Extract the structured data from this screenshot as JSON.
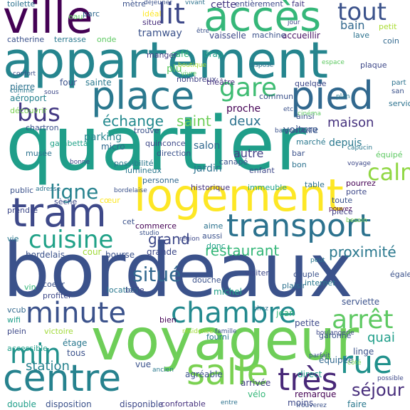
{
  "words": [
    {
      "text": "quartier",
      "color": "#1f9e89"
    },
    {
      "text": "bordeaux",
      "color": "#3b528b"
    },
    {
      "text": "appartement",
      "color": "#25858e"
    },
    {
      "text": "voyageur",
      "color": "#6ece58"
    },
    {
      "text": "logement",
      "color": "#fde725"
    },
    {
      "text": "ville",
      "color": "#440154"
    },
    {
      "text": "accès",
      "color": "#35b779"
    },
    {
      "text": "place",
      "color": "#2a788e"
    },
    {
      "text": "pied",
      "color": "#31688e"
    },
    {
      "text": "tram",
      "color": "#3e4989"
    },
    {
      "text": "transport",
      "color": "#2c728e"
    },
    {
      "text": "centre",
      "color": "#26828e"
    },
    {
      "text": "chambre",
      "color": "#23898e"
    },
    {
      "text": "minute",
      "color": "#3b528b"
    },
    {
      "text": "salle",
      "color": "#7ad151"
    },
    {
      "text": "très",
      "color": "#482878"
    },
    {
      "text": "rue",
      "color": "#21918c"
    },
    {
      "text": "arrêt",
      "color": "#5ec962"
    },
    {
      "text": "cuisine",
      "color": "#1fa187"
    },
    {
      "text": "min",
      "color": "#21918c"
    },
    {
      "text": "gare",
      "color": "#3fbc73"
    },
    {
      "text": "lit",
      "color": "#3e4989"
    },
    {
      "text": "tout",
      "color": "#3b528b"
    },
    {
      "text": "bus",
      "color": "#443983"
    },
    {
      "text": "calme",
      "color": "#90d743"
    },
    {
      "text": "ligne",
      "color": "#26828e"
    },
    {
      "text": "situé",
      "color": "#31688e"
    },
    {
      "text": "restaurant",
      "color": "#35b779"
    },
    {
      "text": "proximité",
      "color": "#2a788e"
    },
    {
      "text": "séjour",
      "color": "#472d7b"
    },
    {
      "text": "station",
      "color": "#26828e"
    },
    {
      "text": "grand",
      "color": "#3e4989"
    },
    {
      "text": "maison",
      "color": "#46327e"
    },
    {
      "text": "saint",
      "color": "#6ece58"
    },
    {
      "text": "deux",
      "color": "#2c728e"
    },
    {
      "text": "échange",
      "color": "#23898e"
    },
    {
      "text": "proche",
      "color": "#440154"
    },
    {
      "text": "quai",
      "color": "#1f9e89"
    },
    {
      "text": "bain",
      "color": "#31688e"
    },
    {
      "text": "tramway",
      "color": "#3b528b"
    },
    {
      "text": "cette",
      "color": "#453781"
    },
    {
      "text": "jardin",
      "color": "#2c728e"
    },
    {
      "text": "autre",
      "color": "#424086"
    },
    {
      "text": "parking",
      "color": "#25858e"
    },
    {
      "text": "salon",
      "color": "#31688e"
    },
    {
      "text": "depuis",
      "color": "#2a788e"
    },
    {
      "text": "voiture",
      "color": "#38588c"
    },
    {
      "text": "plu",
      "color": "#5ec962"
    },
    {
      "text": "vaisselle",
      "color": "#3e4989"
    },
    {
      "text": "accueillir",
      "color": "#471164"
    },
    {
      "text": "terrasse",
      "color": "#2a788e"
    },
    {
      "text": "catherine",
      "color": "#3b528b"
    },
    {
      "text": "pierre",
      "color": "#2c728e"
    },
    {
      "text": "aéroport",
      "color": "#26828e"
    },
    {
      "text": "chartron",
      "color": "#3b528b"
    },
    {
      "text": "quelque",
      "color": "#3e4989"
    },
    {
      "text": "commerce",
      "color": "#440154"
    },
    {
      "text": "historique",
      "color": "#46327e"
    },
    {
      "text": "immeuble",
      "color": "#1fa187"
    },
    {
      "text": "personne",
      "color": "#31688e"
    },
    {
      "text": "toute",
      "color": "#3b528b"
    },
    {
      "text": "pièce",
      "color": "#423f85"
    },
    {
      "text": "vcub",
      "color": "#31688e"
    },
    {
      "text": "wifi",
      "color": "#1f9e89"
    },
    {
      "text": "plein",
      "color": "#3e4989"
    },
    {
      "text": "victoire",
      "color": "#a0da39"
    },
    {
      "text": "tous",
      "color": "#3b528b"
    },
    {
      "text": "étage",
      "color": "#2a788e"
    },
    {
      "text": "disposition",
      "color": "#3b528b"
    },
    {
      "text": "disponible",
      "color": "#3e4989"
    },
    {
      "text": "arrivée",
      "color": "#433e85"
    },
    {
      "text": "vélo",
      "color": "#35b779"
    },
    {
      "text": "moins",
      "color": "#3e4989"
    },
    {
      "text": "remarque",
      "color": "#440154"
    },
    {
      "text": "faire",
      "color": "#2a788e"
    },
    {
      "text": "équipée",
      "color": "#31688e"
    },
    {
      "text": "linge",
      "color": "#3b528b"
    },
    {
      "text": "direct",
      "color": "#1f9e89"
    },
    {
      "text": "agréable",
      "color": "#3b528b"
    },
    {
      "text": "confortable",
      "color": "#46327e"
    },
    {
      "text": "double",
      "color": "#1f9e89"
    },
    {
      "text": "toilette",
      "color": "#2c728e"
    },
    {
      "text": "eau",
      "color": "#5ec962"
    },
    {
      "text": "parc",
      "color": "#31688e"
    },
    {
      "text": "mètre",
      "color": "#3b528b"
    },
    {
      "text": "idéal",
      "color": "#fde725"
    },
    {
      "text": "situe",
      "color": "#472d7b"
    },
    {
      "text": "fait",
      "color": "#443983"
    },
    {
      "text": "entièrement",
      "color": "#3e4989"
    },
    {
      "text": "onde",
      "color": "#5ec962"
    },
    {
      "text": "machine",
      "color": "#3b528b"
    },
    {
      "text": "lave",
      "color": "#2c728e"
    },
    {
      "text": "coin",
      "color": "#31688e"
    },
    {
      "text": "petit",
      "color": "#aadc32"
    },
    {
      "text": "café",
      "color": "#35b779"
    },
    {
      "text": "drap",
      "color": "#1f9e89"
    },
    {
      "text": "manger",
      "color": "#433e85"
    },
    {
      "text": "sainte",
      "color": "#2a788e"
    },
    {
      "text": "four",
      "color": "#3b528b"
    },
    {
      "text": "nombreux",
      "color": "#414487"
    },
    {
      "text": "théâtre",
      "color": "#46327e"
    },
    {
      "text": "commun",
      "color": "#3b528b"
    },
    {
      "text": "plaque",
      "color": "#3e4989"
    },
    {
      "text": "ainsi",
      "color": "#3b528b"
    },
    {
      "text": "découvrir",
      "color": "#7ad151"
    },
    {
      "text": "musée",
      "color": "#2c728e"
    },
    {
      "text": "gambetta",
      "color": "#1fa187"
    },
    {
      "text": "trouve",
      "color": "#3b528b"
    },
    {
      "text": "micro",
      "color": "#31688e"
    },
    {
      "text": "quinconce",
      "color": "#3e4989"
    },
    {
      "text": "direction",
      "color": "#3b528b"
    },
    {
      "text": "lumineux",
      "color": "#2a788e"
    },
    {
      "text": "canapé",
      "color": "#3b528b"
    },
    {
      "text": "enfant",
      "color": "#3e4989"
    },
    {
      "text": "marché",
      "color": "#2a788e"
    },
    {
      "text": "bar",
      "color": "#3b528b"
    },
    {
      "text": "bon",
      "color": "#2c728e"
    },
    {
      "text": "jusqu",
      "color": "#3b528b"
    },
    {
      "text": "pourrez",
      "color": "#440154"
    },
    {
      "text": "porte",
      "color": "#3e4989"
    },
    {
      "text": "table",
      "color": "#2c728e"
    },
    {
      "text": "public",
      "color": "#3b528b"
    },
    {
      "text": "sèche",
      "color": "#3e4989"
    },
    {
      "text": "possibilité",
      "color": "#2a788e"
    },
    {
      "text": "cœur",
      "color": "#fde725"
    },
    {
      "text": "prendre",
      "color": "#3e4989"
    },
    {
      "text": "cet",
      "color": "#3b528b"
    },
    {
      "text": "aime",
      "color": "#2c728e"
    },
    {
      "text": "aussi",
      "color": "#3b528b"
    },
    {
      "text": "donc",
      "color": "#1fa187"
    },
    {
      "text": "bordelais",
      "color": "#3b528b"
    },
    {
      "text": "cour",
      "color": "#a0da39"
    },
    {
      "text": "bourse",
      "color": "#3b528b"
    },
    {
      "text": "grande",
      "color": "#3e4989"
    },
    {
      "text": "vie",
      "color": "#2a788e"
    },
    {
      "text": "coeur",
      "color": "#3b528b"
    },
    {
      "text": "vin",
      "color": "#35b779"
    },
    {
      "text": "profiter",
      "color": "#3e4989"
    },
    {
      "text": "location",
      "color": "#2a788e"
    },
    {
      "text": "belle",
      "color": "#3e4989"
    },
    {
      "text": "bien",
      "color": "#440154"
    },
    {
      "text": "douche",
      "color": "#3b528b"
    },
    {
      "text": "michel",
      "color": "#1fa187"
    },
    {
      "text": "visiter",
      "color": "#3e4989"
    },
    {
      "text": "plaisir",
      "color": "#2c728e"
    },
    {
      "text": "couple",
      "color": "#3b528b"
    },
    {
      "text": "internet",
      "color": "#2a788e"
    },
    {
      "text": "également",
      "color": "#3b528b"
    },
    {
      "text": "serviette",
      "color": "#3b528b"
    },
    {
      "text": "jean",
      "color": "#35b779"
    },
    {
      "text": "petite",
      "color": "#3e4989"
    },
    {
      "text": "garonne",
      "color": "#3b528b"
    },
    {
      "text": "fourni",
      "color": "#2a788e"
    },
    {
      "text": "vue",
      "color": "#3b528b"
    },
    {
      "text": "accessible",
      "color": "#1f9e89"
    },
    {
      "text": "service",
      "color": "#2c728e"
    },
    {
      "text": "équipé",
      "color": "#5ec962"
    },
    {
      "text": "famille",
      "color": "#3b528b"
    },
    {
      "text": "résidence",
      "color": "#a0da39"
    },
    {
      "text": "boulangerie",
      "color": "#3e4989"
    },
    {
      "text": "chez",
      "color": "#2c728e"
    },
    {
      "text": "parfait",
      "color": "#3b528b"
    },
    {
      "text": "côté",
      "color": "#7ad151"
    },
    {
      "text": "ancien",
      "color": "#2a788e"
    },
    {
      "text": "trouverez",
      "color": "#3b528b"
    },
    {
      "text": "possible",
      "color": "#3e4989"
    },
    {
      "text": "entre",
      "color": "#2c728e"
    },
    {
      "text": "besoin",
      "color": "#7ad151"
    },
    {
      "text": "région",
      "color": "#3e4989"
    },
    {
      "text": "studio",
      "color": "#3b528b"
    },
    {
      "text": "peut",
      "color": "#2a788e"
    },
    {
      "text": "pouvez",
      "color": "#440154"
    },
    {
      "text": "adresse",
      "color": "#2c728e"
    },
    {
      "text": "bordelaise",
      "color": "#3b528b"
    },
    {
      "text": "bonne",
      "color": "#3e4989"
    },
    {
      "text": "capucin",
      "color": "#2a788e"
    },
    {
      "text": "baignoire",
      "color": "#3b528b"
    },
    {
      "text": "cinéma",
      "color": "#5ec962"
    },
    {
      "text": "voyage",
      "color": "#3e4989"
    },
    {
      "text": "etc",
      "color": "#3b528b"
    },
    {
      "text": "dispose",
      "color": "#2c728e"
    },
    {
      "text": "confort",
      "color": "#3b528b"
    },
    {
      "text": "comme",
      "color": "#2a788e"
    },
    {
      "text": "sous",
      "color": "#3e4989"
    },
    {
      "text": "boutique",
      "color": "#aadc32"
    },
    {
      "text": "vivre",
      "color": "#5ec962"
    },
    {
      "text": "déjeuner",
      "color": "#3b528b"
    },
    {
      "text": "vivant",
      "color": "#2c728e"
    },
    {
      "text": "jour",
      "color": "#3e4989"
    },
    {
      "text": "être",
      "color": "#3b528b"
    },
    {
      "text": "espace",
      "color": "#5ec962"
    },
    {
      "text": "plan",
      "color": "#2a788e"
    },
    {
      "text": "san",
      "color": "#3b528b"
    },
    {
      "text": "part",
      "color": "#2c728e"
    }
  ]
}
